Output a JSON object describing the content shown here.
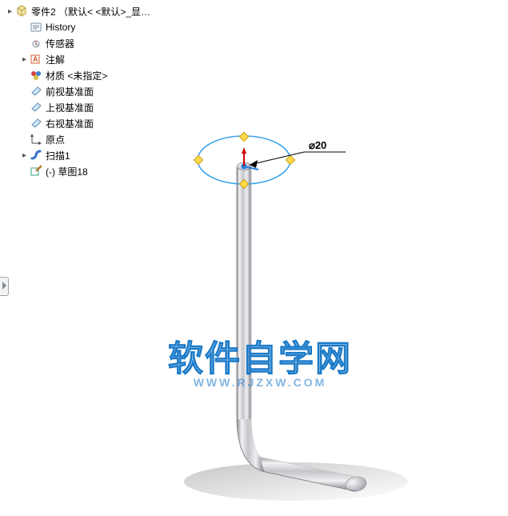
{
  "tree": {
    "root_label": "零件2 （默认< <默认>_显…",
    "items": [
      {
        "label": "History",
        "icon": "history"
      },
      {
        "label": "传感器",
        "icon": "sensor"
      },
      {
        "label": "注解",
        "icon": "annotation"
      },
      {
        "label": "材质 <未指定>",
        "icon": "material"
      },
      {
        "label": "前视基准面",
        "icon": "plane"
      },
      {
        "label": "上视基准面",
        "icon": "plane"
      },
      {
        "label": "右视基准面",
        "icon": "plane"
      },
      {
        "label": "原点",
        "icon": "origin"
      },
      {
        "label": "扫描1",
        "icon": "sweep"
      },
      {
        "label": "(-) 草图18",
        "icon": "sketch"
      }
    ],
    "expanders": {
      "root": "▸",
      "annotation_idx": 2,
      "sweep_idx": 8
    }
  },
  "dimension": {
    "callout": "⌀20"
  },
  "watermark": {
    "main": "软件自学网",
    "sub": "WWW.RJZXW.COM"
  }
}
